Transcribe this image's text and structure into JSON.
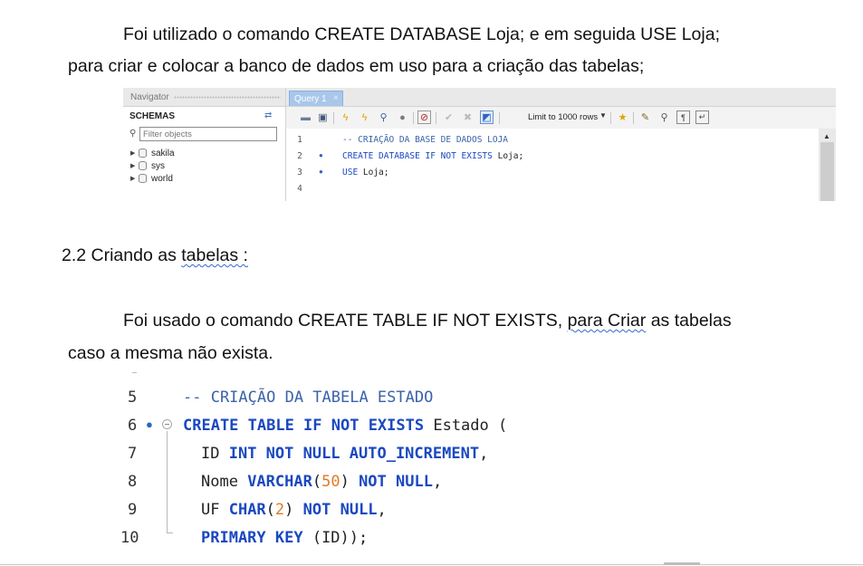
{
  "paragraph1": {
    "line1": "Foi utilizado o comando CREATE DATABASE Loja; e em seguida USE Loja;",
    "line2": "para criar e colocar a banco de dados em uso para a criação das tabelas;"
  },
  "workbench": {
    "navigator_title": "Navigator",
    "schemas_label": "SCHEMAS",
    "filter_placeholder": "Filter objects",
    "schemas": [
      "sakila",
      "sys",
      "world"
    ],
    "tab_label": "Query 1",
    "tab_close": "×",
    "limit_label": "Limit to 1000 rows",
    "line_numbers": [
      "1",
      "2",
      "3",
      "4"
    ],
    "code": {
      "line1": "-- CRIAÇÃO DA BASE DE DADOS LOJA",
      "line2_kw": "CREATE DATABASE IF NOT EXISTS",
      "line2_id": " Loja;",
      "line3_kw": "USE",
      "line3_id": " Loja;"
    }
  },
  "heading": {
    "prefix": "2.2  Criando as ",
    "word": "tabelas :"
  },
  "paragraph2": {
    "line1_start": "Foi usado o comando CREATE TABLE IF NOT EXISTS, ",
    "line1_link": "para Criar",
    "line1_end": " as tabelas",
    "line2": "caso a mesma não exista."
  },
  "code_block": {
    "line_numbers": [
      "5",
      "6",
      "7",
      "8",
      "9",
      "10"
    ],
    "comment": "-- CRIAÇÃO DA TABELA ESTADO",
    "l6_kw": "CREATE TABLE IF NOT EXISTS",
    "l6_id": " Estado (",
    "l7_id": "ID ",
    "l7_kw": "INT NOT NULL AUTO_INCREMENT",
    "l7_end": ",",
    "l8_id": "Nome ",
    "l8_kw": "VARCHAR",
    "l8_p1": "(",
    "l8_num": "50",
    "l8_p2": ") ",
    "l8_kw2": "NOT NULL",
    "l8_end": ",",
    "l9_id": "UF ",
    "l9_kw": "CHAR",
    "l9_p1": "(",
    "l9_num": "2",
    "l9_p2": ") ",
    "l9_kw2": "NOT NULL",
    "l9_end": ",",
    "l10_kw": "PRIMARY KEY",
    "l10_id": " (ID));"
  }
}
